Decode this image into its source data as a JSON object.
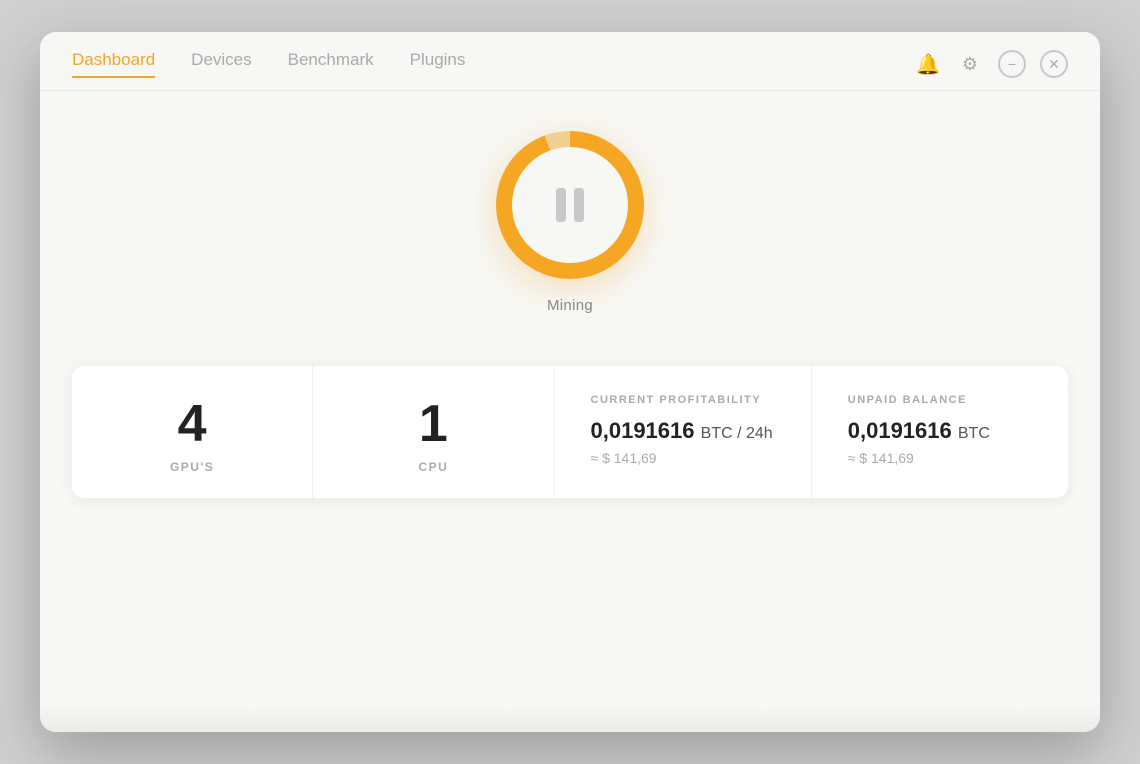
{
  "nav": {
    "tabs": [
      {
        "label": "Dashboard",
        "active": true
      },
      {
        "label": "Devices",
        "active": false
      },
      {
        "label": "Benchmark",
        "active": false
      },
      {
        "label": "Plugins",
        "active": false
      }
    ]
  },
  "mining": {
    "label": "Mining",
    "state": "paused"
  },
  "stats": {
    "gpu_count": "4",
    "gpu_label": "GPU'S",
    "cpu_count": "1",
    "cpu_label": "CPU",
    "profitability": {
      "title": "CURRENT PROFITABILITY",
      "btc_value": "0,0191616",
      "btc_unit": "BTC / 24h",
      "usd_approx": "≈ $ 141,69"
    },
    "balance": {
      "title": "UNPAID BALANCE",
      "btc_value": "0,0191616",
      "btc_unit": "BTC",
      "usd_approx": "≈ $ 141,69"
    }
  },
  "controls": {
    "bell_icon": "🔔",
    "gear_icon": "⚙",
    "minimize_icon": "−",
    "close_icon": "✕"
  }
}
